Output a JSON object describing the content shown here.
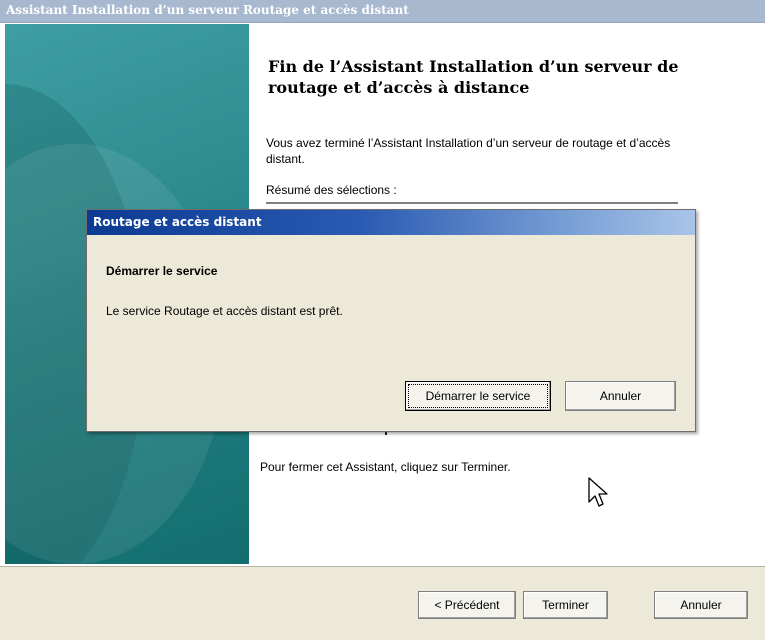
{
  "wizard": {
    "title": "Assistant Installation d’un serveur Routage et accès distant",
    "heading": "Fin de l’Assistant Installation d’un serveur de routage et d’accès à distance",
    "completed_text": "Vous avez terminé l’Assistant Installation d’un serveur de routage et d’accès distant.",
    "summary_label": "Résumé des sélections :",
    "close_instruction": "Pour fermer cet Assistant, cliquez sur Terminer.",
    "buttons": {
      "previous": "< Précédent",
      "finish": "Terminer",
      "cancel": "Annuler"
    }
  },
  "dialog": {
    "title": "Routage et accès distant",
    "heading": "Démarrer le service",
    "message": "Le service Routage et accès distant est prêt.",
    "buttons": {
      "start": "Démarrer le service",
      "cancel": "Annuler"
    }
  },
  "colors": {
    "side_panel": "#2f8d90",
    "dialog_title_start": "#0b3a93",
    "dialog_title_end": "#a9c4e8",
    "wizard_titlebar": "#a8b9cf"
  },
  "icons": {
    "cursor": "mouse-pointer-icon"
  }
}
